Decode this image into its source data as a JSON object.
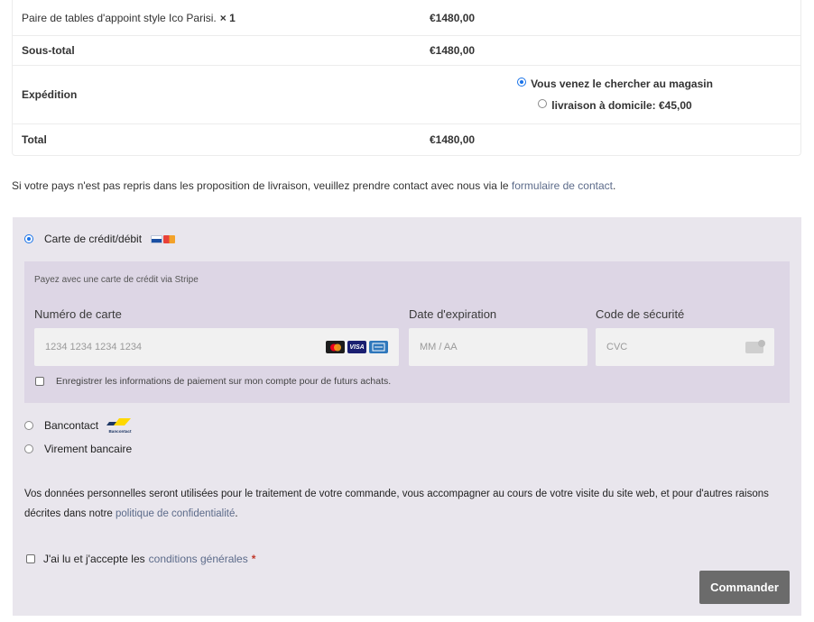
{
  "summary": {
    "product": {
      "name": "Paire de tables d'appoint style Ico Parisi.",
      "qty": "× 1",
      "price": "€1480,00"
    },
    "subtotal": {
      "label": "Sous-total",
      "value": "€1480,00"
    },
    "shipping": {
      "label": "Expédition",
      "options": [
        {
          "label": "Vous venez le chercher au magasin",
          "selected": true
        },
        {
          "label": "livraison à domicile: €45,00",
          "selected": false
        }
      ]
    },
    "total": {
      "label": "Total",
      "value": "€1480,00"
    }
  },
  "notice": {
    "text": "Si votre pays n'est pas repris dans les proposition de livraison, veuillez prendre contact avec nous via le ",
    "link": "formulaire de contact",
    "suffix": "."
  },
  "payment": {
    "methods": {
      "card": {
        "label": "Carte de crédit/débit",
        "selected": true
      },
      "bancontact": {
        "label": "Bancontact",
        "selected": false,
        "logo_text": "Bancontact"
      },
      "virement": {
        "label": "Virement bancaire",
        "selected": false
      }
    },
    "stripe": {
      "caption": "Payez avec une carte de crédit via Stripe",
      "number_label": "Numéro de carte",
      "number_placeholder": "1234 1234 1234 1234",
      "exp_label": "Date d'expiration",
      "exp_placeholder": "MM / AA",
      "cvc_label": "Code de sécurité",
      "cvc_placeholder": "CVC",
      "brands": [
        "mastercard-icon",
        "visa-icon",
        "amex-icon"
      ],
      "visa_text": "VISA",
      "save_label": "Enregistrer les informations de paiement sur mon compte pour de futurs achats."
    },
    "privacy": {
      "text": "Vos données personnelles seront utilisées pour le traitement de votre commande, vous accompagner au cours de votre visite du site web, et pour d'autres raisons décrites dans notre ",
      "link": "politique de confidentialité",
      "suffix": "."
    },
    "terms": {
      "text": "J'ai lu et j'accepte les",
      "link": "conditions générales",
      "required": "*"
    },
    "order_button": "Commander"
  },
  "colors": {
    "panel": "#e9e6ed",
    "stripe_panel": "#ddd6e5",
    "link": "#5c6b8a",
    "button": "#6b6b6b",
    "radio_accent": "#1a73e8"
  }
}
